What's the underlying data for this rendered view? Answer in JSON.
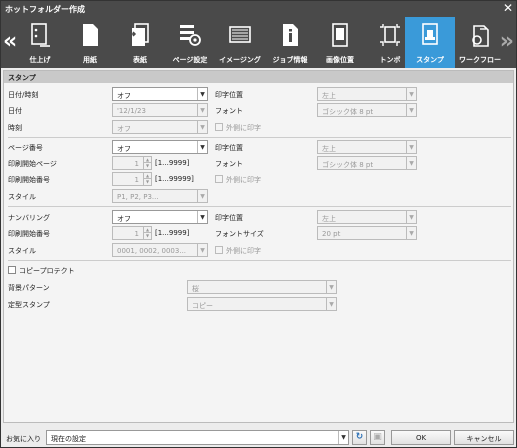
{
  "window": {
    "title": "ホットフォルダー作成",
    "close": "✕"
  },
  "toolbar": {
    "prev": "«",
    "next": "»",
    "tabs": [
      {
        "label": "仕上げ",
        "icon": "finishing-icon"
      },
      {
        "label": "用紙",
        "icon": "paper-icon"
      },
      {
        "label": "表紙",
        "icon": "cover-icon"
      },
      {
        "label": "ページ設定",
        "icon": "page-settings-icon"
      },
      {
        "label": "イメージング",
        "icon": "imaging-icon"
      },
      {
        "label": "ジョブ情報",
        "icon": "job-info-icon"
      },
      {
        "label": "画像位置",
        "icon": "image-position-icon"
      },
      {
        "label": "トンボ",
        "icon": "crop-marks-icon"
      },
      {
        "label": "スタンプ",
        "icon": "stamp-icon",
        "active": true
      },
      {
        "label": "ワークフロー",
        "icon": "workflow-icon"
      }
    ]
  },
  "stamp": {
    "section_title": "スタンプ",
    "date": {
      "label_datetime": "日付/時刻",
      "datetime_value": "オフ",
      "label_date": "日付",
      "date_value": "'12/1/23",
      "label_time": "時刻",
      "time_value": "オフ",
      "label_position": "印字位置",
      "position_value": "左上",
      "label_font": "フォント",
      "font_value": "ゴシック体 8 pt",
      "outside_print": "外側に印字"
    },
    "page_number": {
      "label": "ページ番号",
      "value": "オフ",
      "label_start_page": "印刷開始ページ",
      "start_page": "1",
      "start_page_range": "[1...9999]",
      "label_start_number": "印刷開始番号",
      "start_number": "1",
      "start_number_range": "[1...99999]",
      "label_style": "スタイル",
      "style_value": "P1, P2, P3...",
      "label_position": "印字位置",
      "position_value": "左上",
      "label_font": "フォント",
      "font_value": "ゴシック体 8 pt",
      "outside_print": "外側に印字"
    },
    "numbering": {
      "label": "ナンバリング",
      "value": "オフ",
      "label_start_number": "印刷開始番号",
      "start_number": "1",
      "start_number_range": "[1...9999]",
      "label_style": "スタイル",
      "style_value": "0001, 0002, 0003...",
      "label_position": "印字位置",
      "position_value": "左上",
      "label_font_size": "フォントサイズ",
      "font_size_value": "20 pt",
      "outside_print": "外側に印字"
    },
    "copy_protect": {
      "label": "コピープロテクト",
      "label_pattern": "背景パターン",
      "pattern_value": "桜",
      "label_stamp": "定型スタンプ",
      "stamp_value": "コピー"
    }
  },
  "footer": {
    "favorites_label": "お気に入り",
    "favorites_value": "現在の設定",
    "ok": "OK",
    "cancel": "キャンセル"
  }
}
